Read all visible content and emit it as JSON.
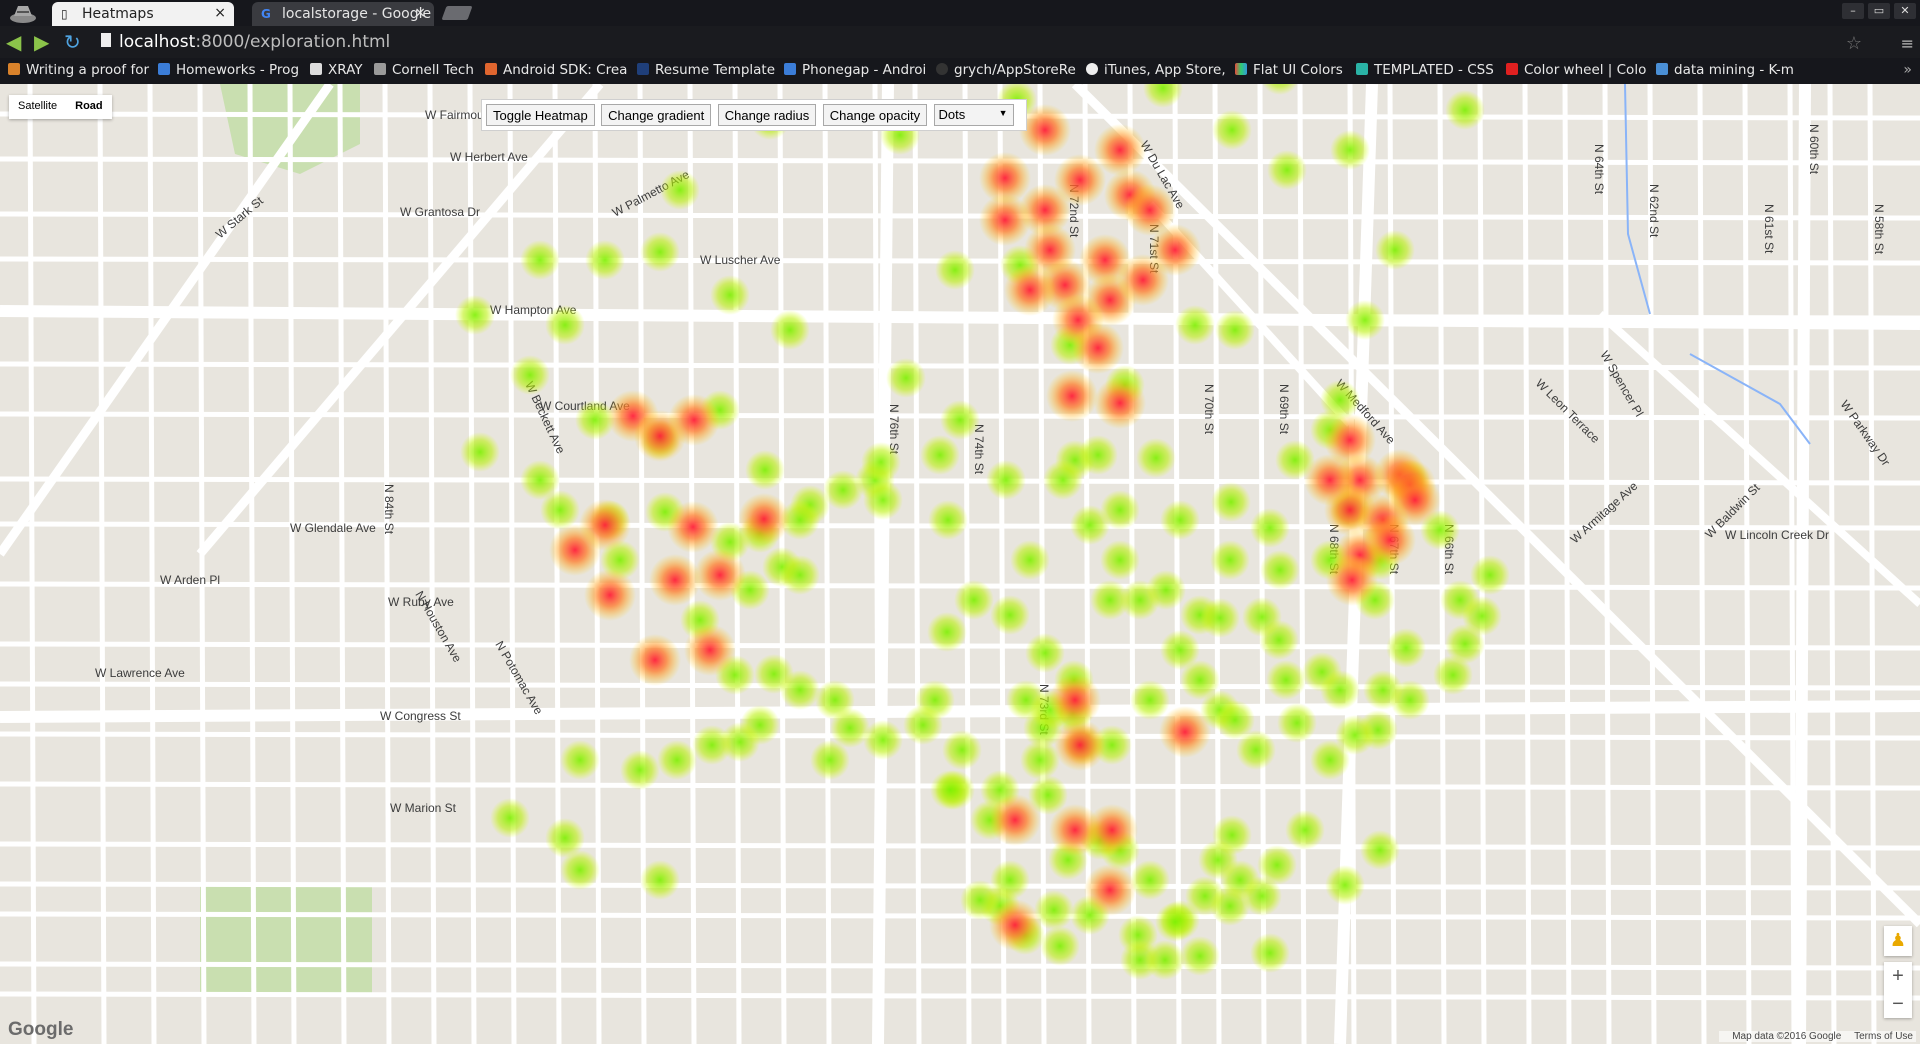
{
  "browser": {
    "tabs": [
      {
        "title": "Heatmaps",
        "close": "×"
      },
      {
        "title": "localstorage - Google",
        "close": "×"
      }
    ],
    "window_controls": [
      "–",
      "▭",
      "✕"
    ],
    "url_host": "localhost",
    "url_path": ":8000/exploration.html",
    "bookmarks": [
      "Writing a proof for",
      "Homeworks - Prog",
      "XRAY",
      "Cornell Tech",
      "Android SDK: Crea",
      "Resume Template",
      "Phonegap - Androi",
      "grych/AppStoreRe",
      "iTunes, App Store,",
      "Flat UI Colors",
      "TEMPLATED - CSS",
      "Color wheel | Colo",
      "data mining - K-m"
    ],
    "bookmarks_more": "»"
  },
  "map": {
    "type_buttons": {
      "satellite": "Satellite",
      "road": "Road"
    },
    "controls": {
      "toggle": "Toggle Heatmap",
      "gradient": "Change gradient",
      "radius": "Change radius",
      "opacity": "Change opacity",
      "select_value": "Dots"
    },
    "zoom_in": "+",
    "zoom_out": "−",
    "google": "Google",
    "map_data": "Map data ©2016 Google",
    "terms": "Terms of Use",
    "street_labels": [
      "W Fairmount Ave",
      "W Herbert Ave",
      "W Stark St",
      "W Grantosa Dr",
      "W Luscher Ave",
      "W Hampton Ave",
      "W Courtland Ave",
      "W Glendale Ave",
      "W Arden Pl",
      "W Ruby Ave",
      "W Lawrence Ave",
      "W Congress St",
      "W Marion St",
      "W Palmetto Ave",
      "W Medford Ave",
      "W Lincoln Creek Dr",
      "W Leon Terrace",
      "W Spencer Pl",
      "W Armitage Ave",
      "W Baldwin St",
      "W Parkway Dr",
      "N 84th St",
      "N 76th St",
      "N 74th St",
      "N 73rd St",
      "N 72nd St",
      "N 71st St",
      "N 70th St",
      "N 69th St",
      "N 68th St",
      "N 67th St",
      "N 66th St",
      "N 60th St",
      "N 64th St",
      "N 62nd St",
      "N 61st St",
      "N 58th St",
      "N Houston Ave",
      "N Potomac Ave",
      "W Du Lac Ave",
      "W Beckett Ave"
    ]
  }
}
